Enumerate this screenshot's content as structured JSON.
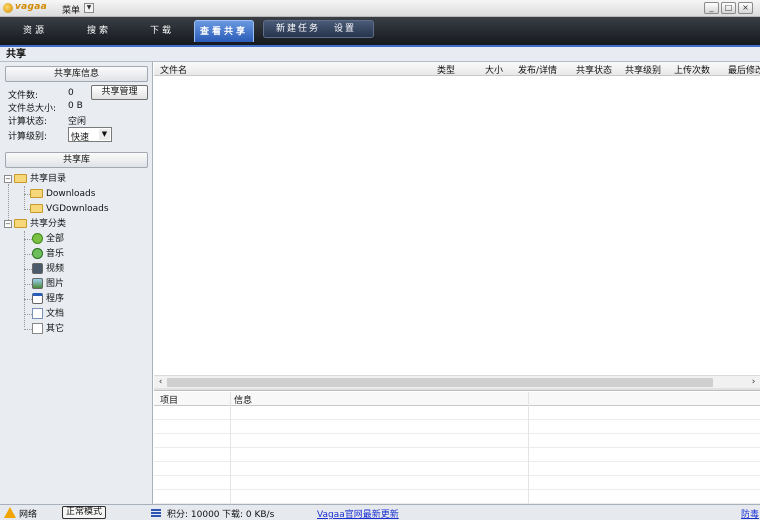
{
  "app": {
    "logo_text": "vagaa",
    "menu_label": "菜单"
  },
  "window_controls": [
    "_",
    "□",
    "×"
  ],
  "nav": {
    "tabs": [
      "资源",
      "搜索",
      "下载",
      "查看共享"
    ],
    "active_tab": "查看共享",
    "secondary_tabs": [
      "新建任务",
      "设置"
    ]
  },
  "section_title": "共享",
  "library_info": {
    "header": "共享库信息",
    "file_count_label": "文件数:",
    "file_count": "0",
    "total_size_label": "文件总大小:",
    "total_size": "0 B",
    "manage_button": "共享管理",
    "calc_status_label": "计算状态:",
    "calc_status": "空闲",
    "calc_level_label": "计算级别:",
    "calc_level": "快速"
  },
  "library": {
    "header": "共享库",
    "tree": {
      "dirs_label": "共享目录",
      "dirs": [
        "Downloads",
        "VGDownloads"
      ],
      "categories_label": "共享分类",
      "categories": [
        {
          "label": "全部",
          "icon": "all-icon"
        },
        {
          "label": "音乐",
          "icon": "music-icon"
        },
        {
          "label": "视频",
          "icon": "video-icon"
        },
        {
          "label": "图片",
          "icon": "image-icon"
        },
        {
          "label": "程序",
          "icon": "program-icon"
        },
        {
          "label": "文档",
          "icon": "document-icon"
        },
        {
          "label": "其它",
          "icon": "other-icon"
        }
      ]
    }
  },
  "file_table": {
    "columns": [
      "文件名",
      "类型",
      "大小",
      "发布/详情",
      "共享状态",
      "共享级别",
      "上传次数",
      "最后修改"
    ]
  },
  "info_table": {
    "columns": [
      "项目",
      "信息"
    ]
  },
  "status_bar": {
    "network": "网络",
    "mode": "正常模式",
    "points": "积分: 10000",
    "download": "下载: 0 KB/s",
    "update_link": "Vagaa官网最新更新",
    "right_link": "防毒"
  },
  "colors": {
    "nav_dark": "#15181d",
    "tab_active": "#2a5cb8",
    "accent_blue": "#3d6ec9",
    "link": "#1a2fd0"
  }
}
